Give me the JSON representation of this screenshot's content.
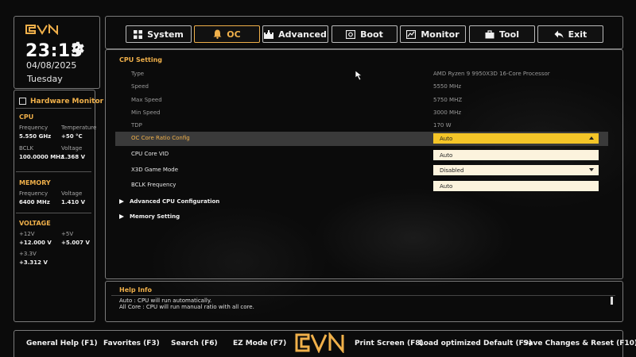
{
  "brand": "CVN",
  "clock": {
    "time": "23:13",
    "date": "04/08/2025",
    "day": "Tuesday"
  },
  "hardware_monitor": {
    "title": "Hardware Monitor",
    "cpu": {
      "section": "CPU",
      "frequency_label": "Frequency",
      "frequency": "5.550 GHz",
      "temperature_label": "Temperature",
      "temperature": "+50 °C",
      "bclk_label": "BCLK",
      "bclk": "100.0000 MHz",
      "voltage_label": "Voltage",
      "voltage": "1.368 V"
    },
    "memory": {
      "section": "MEMORY",
      "frequency_label": "Frequency",
      "frequency": "6400 MHz",
      "voltage_label": "Voltage",
      "voltage": "1.410 V"
    },
    "voltage": {
      "section": "VOLTAGE",
      "v12_label": "+12V",
      "v12": "+12.000 V",
      "v5_label": "+5V",
      "v5": "+5.007 V",
      "v33_label": "+3.3V",
      "v33": "+3.312 V"
    }
  },
  "tabs": [
    {
      "label": "System",
      "icon": "grid-icon"
    },
    {
      "label": "OC",
      "icon": "bell-icon",
      "active": true
    },
    {
      "label": "Advanced",
      "icon": "castle-icon"
    },
    {
      "label": "Boot",
      "icon": "boot-icon"
    },
    {
      "label": "Monitor",
      "icon": "monitor-icon"
    },
    {
      "label": "Tool",
      "icon": "toolbox-icon"
    },
    {
      "label": "Exit",
      "icon": "back-arrow-icon"
    }
  ],
  "cpu_setting": {
    "title": "CPU Setting",
    "info": [
      {
        "label": "Type",
        "value": "AMD Ryzen 9 9950X3D 16-Core Processor"
      },
      {
        "label": "Speed",
        "value": "5550 MHz"
      },
      {
        "label": "Max Speed",
        "value": "5750 MHZ"
      },
      {
        "label": "Min Speed",
        "value": "3000 MHz"
      },
      {
        "label": "TDP",
        "value": "170 W"
      }
    ],
    "options": [
      {
        "label": "OC Core Ratio Config",
        "value": "Auto",
        "selected": true,
        "dropdown": true
      },
      {
        "label": "CPU Core VID",
        "value": "Auto"
      },
      {
        "label": "X3D Game Mode",
        "value": "Disabled",
        "dropdown": true
      },
      {
        "label": "BCLK Frequency",
        "value": "Auto"
      }
    ],
    "submenus": [
      "Advanced CPU Configuration",
      "Memory Setting"
    ]
  },
  "help": {
    "title": "Help Info",
    "lines": [
      "Auto : CPU will run automatically.",
      "All Core : CPU will run manual ratio with all core."
    ]
  },
  "footer": {
    "keys": [
      "General Help (F1)",
      "Favorites (F3)",
      "Search (F6)",
      "EZ Mode (F7)",
      "Print Screen (F8)",
      "Load optimized Default (F9)",
      "Save Changes & Reset (F10)"
    ]
  },
  "colors": {
    "accent": "#f0b04a",
    "selected_field": "#f4c528",
    "field": "#fcf3dd"
  }
}
